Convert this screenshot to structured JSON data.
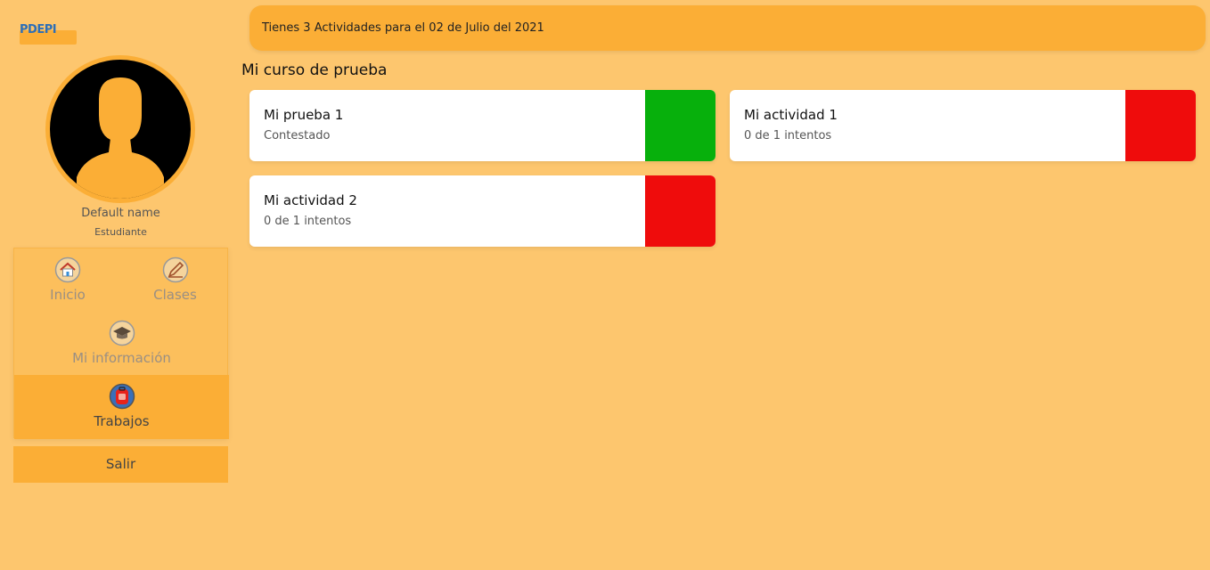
{
  "app": {
    "logo_text": "PDEPI"
  },
  "user": {
    "name": "Default name",
    "role": "Estudiante"
  },
  "nav": {
    "items": [
      {
        "label": "Inicio",
        "icon": "home-icon"
      },
      {
        "label": "Clases",
        "icon": "pencil-icon"
      },
      {
        "label": "Mi información",
        "icon": "graduation-cap-icon"
      },
      {
        "label": "Trabajos",
        "icon": "backpack-icon",
        "active": true
      }
    ],
    "logout_label": "Salir"
  },
  "banner": {
    "text": "Tienes 3 Actividades para el 02 de Julio del 2021"
  },
  "course": {
    "title": "Mi curso de prueba",
    "activities": [
      {
        "title": "Mi prueba 1",
        "status": "Contestado",
        "status_color": "#07b00c"
      },
      {
        "title": "Mi actividad 1",
        "status": "0 de 1 intentos",
        "status_color": "#ef0c0c"
      },
      {
        "title": "Mi actividad 2",
        "status": "0 de 1 intentos",
        "status_color": "#ef0c0c"
      }
    ]
  },
  "colors": {
    "background": "#fdc66e",
    "accent": "#fbae36",
    "done": "#07b00c",
    "pending": "#ef0c0c"
  }
}
